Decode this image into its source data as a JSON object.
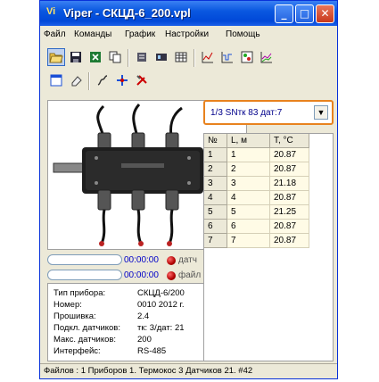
{
  "window": {
    "title": "Viper - СКЦД-6_200.vpl",
    "icon": "Vi"
  },
  "menu": [
    "Файл",
    "Команды",
    "График",
    "Настройки",
    "Помощь"
  ],
  "toolbar1_icons": [
    "open-folder-icon",
    "save-icon",
    "export-excel-icon",
    "copy-icon",
    "device-list-icon",
    "device-add-icon",
    "table-icon",
    "chart-icon",
    "graph-icon",
    "sensor-map-icon",
    "multi-chart-icon"
  ],
  "toolbar2_icons": [
    "window-icon",
    "eraser-icon",
    "probe-icon",
    "network-icon",
    "tools-icon"
  ],
  "timers": [
    {
      "value": "00:00:00",
      "label": "датч"
    },
    {
      "value": "00:00:00",
      "label": "файл"
    }
  ],
  "device_info": {
    "rows": [
      {
        "label": "Тип прибора:",
        "value": "СКЦД-6/200"
      },
      {
        "label": "Номер:",
        "value": "0010  2012 г."
      },
      {
        "label": "Прошивка:",
        "value": "2.4"
      },
      {
        "label": "Подкл. датчиков:",
        "value": "тк: 3/дат: 21"
      },
      {
        "label": "Макс. датчиков:",
        "value": "200"
      },
      {
        "label": "Интерфейс:",
        "value": "RS-485"
      }
    ]
  },
  "sensor_select": {
    "value": "1/3 SNтк 83 дат:7"
  },
  "table": {
    "headers": [
      "№",
      "L, м",
      "T, °C"
    ],
    "rows": [
      [
        "1",
        "1",
        "20.87"
      ],
      [
        "2",
        "2",
        "20.87"
      ],
      [
        "3",
        "3",
        "21.18"
      ],
      [
        "4",
        "4",
        "20.87"
      ],
      [
        "5",
        "5",
        "21.25"
      ],
      [
        "6",
        "6",
        "20.87"
      ],
      [
        "7",
        "7",
        "20.87"
      ]
    ]
  },
  "status": "Файлов : 1  Приборов 1. Термокос 3  Датчиков 21. #42"
}
